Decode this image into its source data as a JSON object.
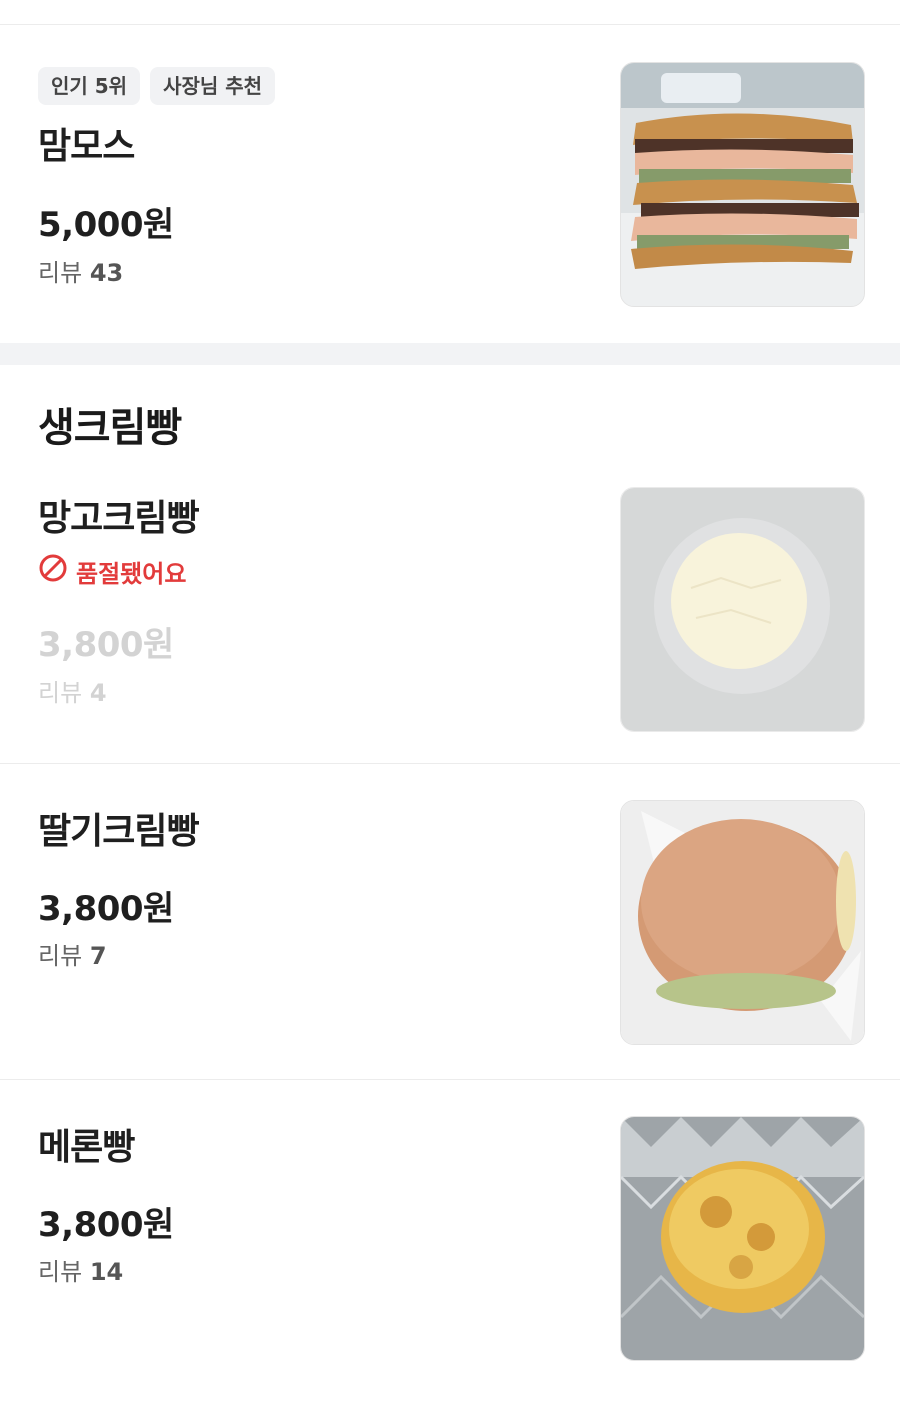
{
  "items": {
    "mammoth": {
      "tags": [
        "인기 5위",
        "사장님 추천"
      ],
      "name": "맘모스",
      "price": "5,000원",
      "review_label": "리뷰",
      "review_count": "43"
    },
    "section_title": "생크림빵",
    "mango": {
      "name": "망고크림빵",
      "status": "품절됐어요",
      "price": "3,800원",
      "review_label": "리뷰",
      "review_count": "4"
    },
    "strawberry": {
      "name": "딸기크림빵",
      "price": "3,800원",
      "review_label": "리뷰",
      "review_count": "7"
    },
    "melon": {
      "name": "메론빵",
      "price": "3,800원",
      "review_label": "리뷰",
      "review_count": "14"
    }
  },
  "colors": {
    "soldout_red": "#e23b3b",
    "muted_gray": "#d3d3d3",
    "tag_bg": "#f1f2f4",
    "band_gray": "#f2f3f5"
  },
  "icons": {
    "soldout": "prohibited-icon"
  }
}
